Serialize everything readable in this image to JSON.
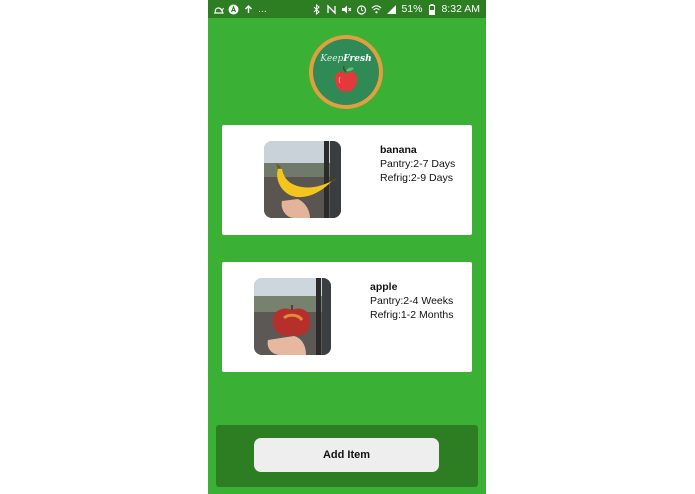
{
  "status_bar": {
    "dots": "...",
    "battery_percent": "51%",
    "time": "8:32 AM",
    "left_icons": [
      "snail-icon",
      "a-circle-icon",
      "upload-icon"
    ],
    "right_icons": [
      "bluetooth-icon",
      "nfc-icon",
      "mute-icon",
      "alarm-icon",
      "wifi-icon",
      "signal-icon",
      "battery-icon"
    ]
  },
  "logo": {
    "text_part1": "Keep",
    "text_part2": "Fresh"
  },
  "items": [
    {
      "name": "banana",
      "pantry": "Pantry:2-7 Days",
      "refrig": "Refrig:2-9 Days"
    },
    {
      "name": "apple",
      "pantry": "Pantry:2-4 Weeks",
      "refrig": "Refrig:1-2 Months"
    }
  ],
  "add_button_label": "Add Item",
  "colors": {
    "background": "#3ab135",
    "status_bar": "#2d7d22",
    "bottom_bar": "#2d7d22",
    "card": "#ffffff",
    "button": "#eeeeee"
  }
}
